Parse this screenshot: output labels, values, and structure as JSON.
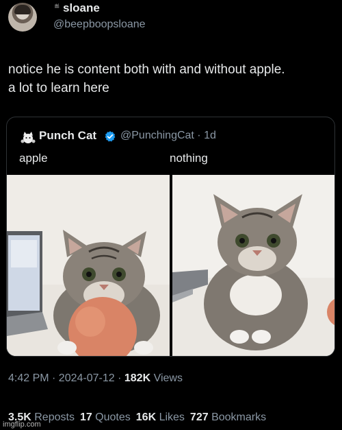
{
  "author": {
    "emoji": "≝",
    "display_name": "sloane",
    "handle": "@beepboopsloane"
  },
  "tweet": {
    "line1": "notice he is content both with and without apple.",
    "line2": "a lot to learn here"
  },
  "quoted": {
    "display_name": "Punch Cat",
    "handle_time": "@PunchingCat · 1d",
    "caption_left": "apple",
    "caption_right": "nothing"
  },
  "meta": {
    "time_date": "4:42 PM · 2024-07-12 · ",
    "views_count": "182K",
    "views_label": " Views"
  },
  "stats": {
    "reposts_count": "3.5K",
    "reposts_label": " Reposts",
    "quotes_count": "17",
    "quotes_label": " Quotes",
    "likes_count": "16K",
    "likes_label": " Likes",
    "bookmarks_count": "727",
    "bookmarks_label": " Bookmarks"
  },
  "watermark": "imgflip.com",
  "colors": {
    "background": "#000000",
    "text": "#e7e9ea",
    "muted": "#8b98a5",
    "verified": "#1d9bf0",
    "border": "#2f3336"
  }
}
